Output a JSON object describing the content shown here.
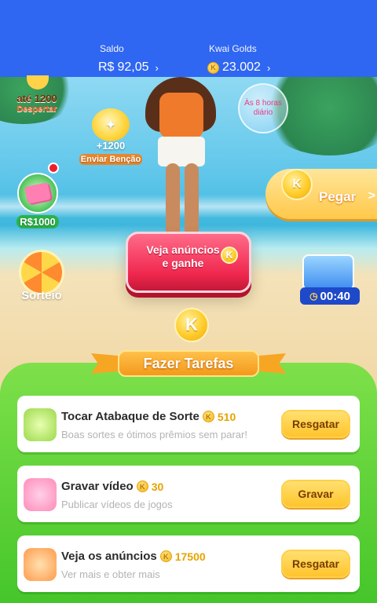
{
  "balance": {
    "saldo_label": "Saldo",
    "saldo_currency": "R$",
    "saldo_value": "92,05",
    "golds_label": "Kwai Golds",
    "golds_value": "23.002",
    "chevron": "›"
  },
  "rewards": {
    "despertar_amount": "até 1200",
    "despertar_label": "Despertar",
    "bencao_amount": "+1200",
    "bencao_label": "Enviar Benção",
    "cash_label": "R$1000",
    "sorteio_label": "Sorteio",
    "daily_label": "Às 8 horas diário",
    "pegar_label": "Pegar",
    "pegar_arrow": ">",
    "timer_value": "00:40"
  },
  "ads_button": {
    "label": "Veja anúncios e ganhe"
  },
  "tasks": {
    "banner_label": "Fazer Tarefas",
    "coin_letter": "K",
    "items": [
      {
        "title": "Tocar Atabaque de Sorte",
        "points": "510",
        "subtitle": "Boas sortes e ótimos prêmios sem parar!",
        "action": "Resgatar",
        "icon": "drum-icon"
      },
      {
        "title": "Gravar vídeo",
        "points": "30",
        "subtitle": "Publicar vídeos de jogos",
        "action": "Gravar",
        "icon": "video-camera-icon"
      },
      {
        "title": "Veja os anúncios",
        "points": "17500",
        "subtitle": "Ver mais e obter mais",
        "action": "Resgatar",
        "icon": "tv-icon"
      }
    ]
  },
  "colors": {
    "topbar": "#2f66f2",
    "panel_green": "#45c62a",
    "ads_red": "#f0284f",
    "action_yellow": "#ffc42c"
  }
}
